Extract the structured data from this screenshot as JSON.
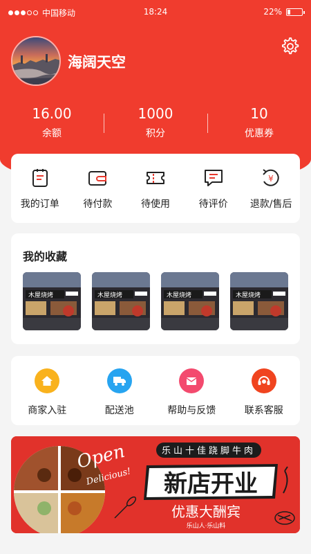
{
  "status_bar": {
    "carrier": "中国移动",
    "time": "18:24",
    "battery": "22%",
    "battery_level": 0.22,
    "signal_bars_filled": 3,
    "signal_bars_total": 5
  },
  "profile": {
    "username": "海阔天空",
    "avatar_icon": "city-sunset-avatar",
    "settings_icon": "gear-icon"
  },
  "stats": [
    {
      "value": "16.00",
      "label": "余额"
    },
    {
      "value": "1000",
      "label": "积分"
    },
    {
      "value": "10",
      "label": "优惠券"
    }
  ],
  "orders": [
    {
      "label": "我的订单",
      "icon": "order-list-icon"
    },
    {
      "label": "待付款",
      "icon": "wallet-icon"
    },
    {
      "label": "待使用",
      "icon": "ticket-icon"
    },
    {
      "label": "待评价",
      "icon": "comment-icon"
    },
    {
      "label": "退款/售后",
      "icon": "refund-icon"
    }
  ],
  "favorites": {
    "title": "我的收藏",
    "items": [
      {
        "sign": "木屋烧烤"
      },
      {
        "sign": "木屋烧烤"
      },
      {
        "sign": "木屋烧烤"
      },
      {
        "sign": "木屋烧烤"
      }
    ]
  },
  "services": [
    {
      "label": "商家入驻",
      "icon": "house-icon",
      "color": "#f9b21d"
    },
    {
      "label": "配送池",
      "icon": "truck-icon",
      "color": "#27a4f0"
    },
    {
      "label": "帮助与反馈",
      "icon": "mail-icon",
      "color": "#f34a6e"
    },
    {
      "label": "联系客服",
      "icon": "headset-icon",
      "color": "#f0441f"
    }
  ],
  "banner": {
    "open": "Open",
    "delicious": "Delicious!",
    "tagline": "乐山十佳跷脚牛肉",
    "headline": "新店开业",
    "subline": "优惠大酬宾",
    "footer": "乐山人·乐山料"
  },
  "colors": {
    "brand_red": "#f03c2e",
    "banner_red": "#e1322b",
    "icon_red": "#e8392e"
  }
}
